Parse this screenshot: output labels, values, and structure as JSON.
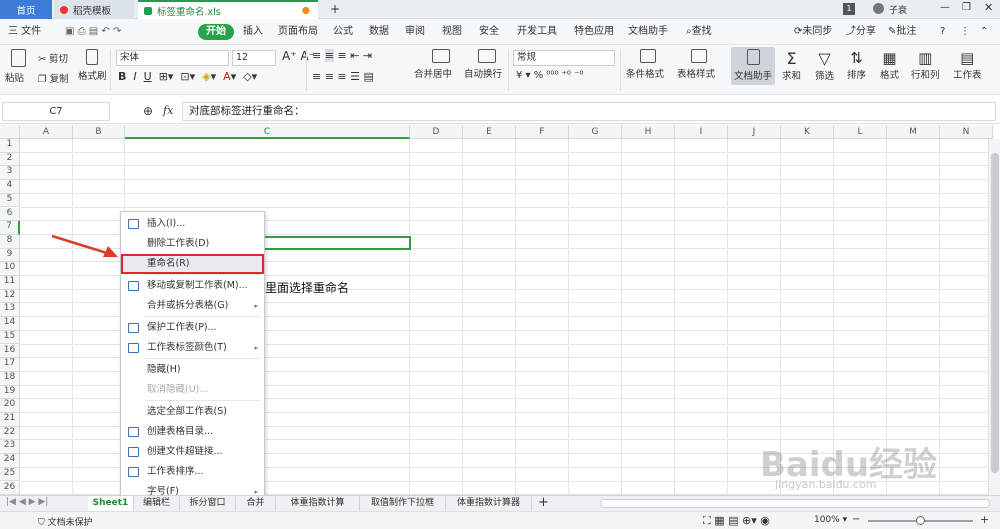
{
  "titlebar": {
    "home_tab": "首页",
    "docer_tab": "稻壳模板",
    "file_tab": "标签重命名.xls",
    "page_num": "1",
    "user": "子衰"
  },
  "menus": [
    "三 文件",
    "开始",
    "插入",
    "页面布局",
    "公式",
    "数据",
    "审阅",
    "视图",
    "安全",
    "开发工具",
    "特色应用",
    "文档助手",
    "查找"
  ],
  "menu_right": {
    "sync": "未同步",
    "share": "分享",
    "annotate": "批注"
  },
  "ribbon": {
    "cut": "剪切",
    "paste": "粘贴",
    "copy": "复制",
    "format_painter": "格式刷",
    "font": "宋体",
    "size": "12",
    "merge": "合并居中",
    "wrap": "自动换行",
    "numfmt": "常规",
    "cond_format": "条件格式",
    "table_style": "表格样式",
    "doc_helper": "文档助手",
    "sum": "求和",
    "filter": "筛选",
    "sort": "排序",
    "format": "格式",
    "rowcol": "行和列",
    "worksheet": "工作表"
  },
  "formula": {
    "cell": "C7",
    "fx": "fx",
    "content": "对底部标签进行重命名："
  },
  "columns": [
    "A",
    "B",
    "C",
    "D",
    "E",
    "F",
    "G",
    "H",
    "I",
    "J",
    "K",
    "L",
    "M",
    "N"
  ],
  "rows": [
    "1",
    "2",
    "3",
    "4",
    "5",
    "6",
    "7",
    "8",
    "9",
    "10",
    "11",
    "12",
    "13",
    "14",
    "15",
    "16",
    "17",
    "18",
    "19",
    "20",
    "21",
    "22",
    "23",
    "24",
    "25",
    "26"
  ],
  "cell_text_row11": "里面选择重命名",
  "context_menu": [
    {
      "label": "插入(I)...",
      "icon": "insert-sheet-icon"
    },
    {
      "label": "删除工作表(D)",
      "icon": ""
    },
    {
      "label": "重命名(R)",
      "icon": "",
      "highlight": true
    },
    {
      "label": "移动或复制工作表(M)...",
      "icon": "move-copy-icon"
    },
    {
      "label": "合并或拆分表格(G)",
      "icon": "",
      "submenu": true
    },
    {
      "label": "保护工作表(P)...",
      "icon": "protect-sheet-icon"
    },
    {
      "label": "工作表标签颜色(T)",
      "icon": "tab-color-icon",
      "submenu": true
    },
    {
      "label": "隐藏(H)",
      "icon": ""
    },
    {
      "label": "取消隐藏(U)...",
      "icon": "",
      "disabled": true
    },
    {
      "label": "选定全部工作表(S)",
      "icon": ""
    },
    {
      "label": "创建表格目录...",
      "icon": "create-toc-icon"
    },
    {
      "label": "创建文件超链接...",
      "icon": "hyperlink-icon"
    },
    {
      "label": "工作表排序...",
      "icon": "sort-sheets-icon"
    },
    {
      "label": "字号(F)",
      "icon": "",
      "submenu": true
    }
  ],
  "sheets": [
    "Sheet1",
    "编辑栏",
    "拆分窗口",
    "合并",
    "体重指数计算",
    "取值制作下拉框",
    "体重指数计算器"
  ],
  "status": {
    "protect": "文档未保护",
    "zoom": "100%"
  },
  "watermark": "Baidu经验",
  "watermark_url": "jingyan.baidu.com",
  "colors": {
    "accent": "#27a34a",
    "highlight_border": "#e0262f",
    "arrow": "#e03a2b",
    "selection": "#2ea043"
  }
}
